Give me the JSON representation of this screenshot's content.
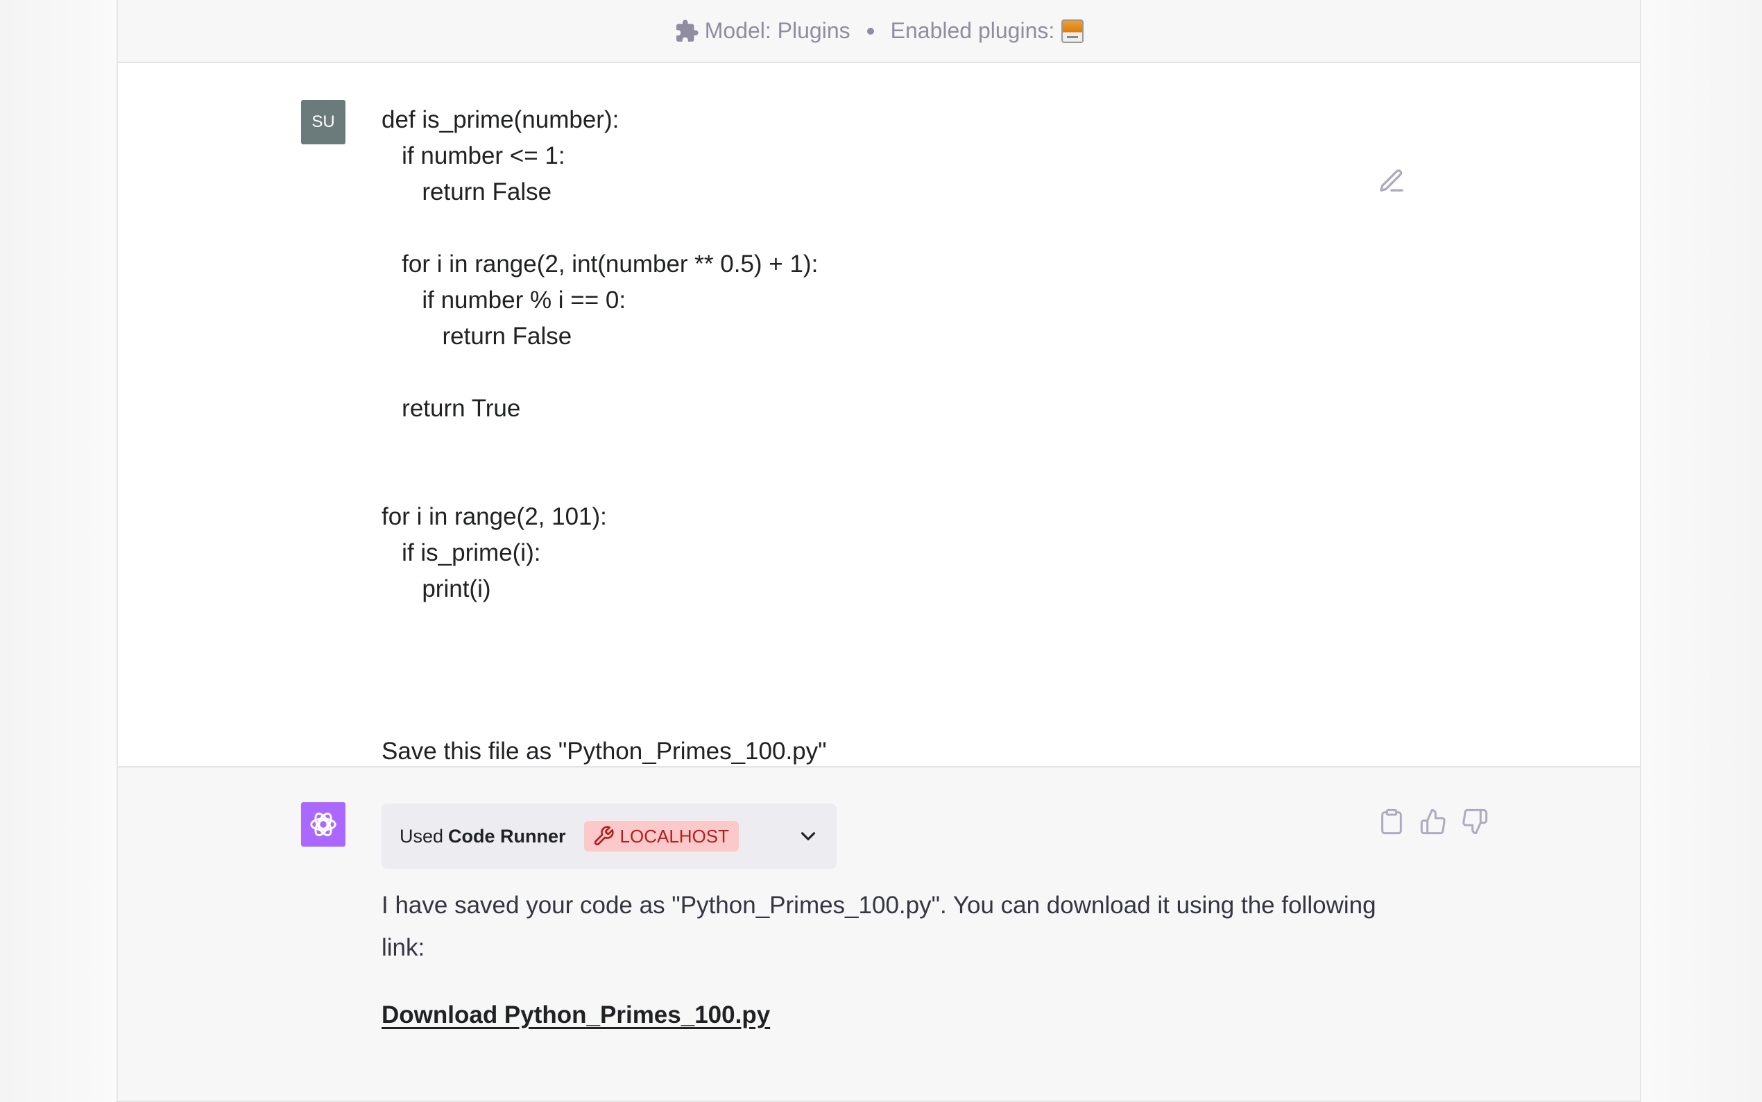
{
  "topbar": {
    "model_label": "Model: Plugins",
    "enabled_label": "Enabled plugins:",
    "icons": [
      "puzzle-icon",
      "plugin-logo-icon"
    ]
  },
  "user_message": {
    "avatar_initials": "SU",
    "code": "def is_prime(number):\n   if number <= 1:\n      return False\n\n   for i in range(2, int(number ** 0.5) + 1):\n      if number % i == 0:\n         return False\n\n   return True\n\n\nfor i in range(2, 101):\n   if is_prime(i):\n      print(i)",
    "instruction": "Save this file as \"Python_Primes_100.py\"",
    "icons": [
      "edit-icon"
    ]
  },
  "assistant_message": {
    "plugin_used_prefix": "Used",
    "plugin_name": "Code Runner",
    "plugin_badge": "LOCALHOST",
    "reply_text": "I have saved your code as \"Python_Primes_100.py\". You can download it using the following link:",
    "download_link": "Download Python_Primes_100.py",
    "icons": [
      "openai-logo-icon",
      "wrench-icon",
      "chevron-down-icon",
      "clipboard-icon",
      "thumbs-up-icon",
      "thumbs-down-icon"
    ]
  },
  "colors": {
    "assistant_avatar": "#ab68ff",
    "user_avatar": "#6b7a7b",
    "badge_bg": "#fbc9c9",
    "badge_text": "#b91c1c"
  }
}
